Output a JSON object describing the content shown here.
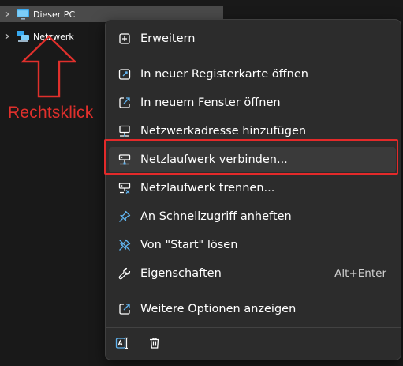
{
  "nav": {
    "items": [
      {
        "label": "Dieser PC",
        "icon": "computer-icon",
        "selected": true
      },
      {
        "label": "Netzwerk",
        "icon": "network-icon",
        "selected": false
      }
    ]
  },
  "annotation": {
    "text": "Rechtsklick",
    "color": "#e0302c"
  },
  "menu": {
    "items": [
      {
        "label": "Erweitern",
        "icon": "expand-icon"
      },
      {
        "label": "In neuer Registerkarte öffnen",
        "icon": "open-tab-icon"
      },
      {
        "label": "In neuem Fenster öffnen",
        "icon": "open-window-icon"
      },
      {
        "label": "Netzwerkadresse hinzufügen",
        "icon": "network-location-icon"
      },
      {
        "label": "Netzlaufwerk verbinden...",
        "icon": "map-drive-icon",
        "highlighted": true
      },
      {
        "label": "Netzlaufwerk trennen...",
        "icon": "disconnect-drive-icon"
      },
      {
        "label": "An Schnellzugriff anheften",
        "icon": "pin-icon"
      },
      {
        "label": "Von \"Start\" lösen",
        "icon": "unpin-icon"
      },
      {
        "label": "Eigenschaften",
        "icon": "wrench-icon",
        "shortcut": "Alt+Enter"
      },
      {
        "label": "Weitere Optionen anzeigen",
        "icon": "more-options-icon"
      }
    ],
    "bottom_icons": [
      "rename-icon",
      "delete-icon"
    ]
  },
  "colors": {
    "background": "#191919",
    "menu_background": "#2c2c2c",
    "highlight_border": "#e32a2a",
    "icon_accent": "#60b4f0"
  }
}
